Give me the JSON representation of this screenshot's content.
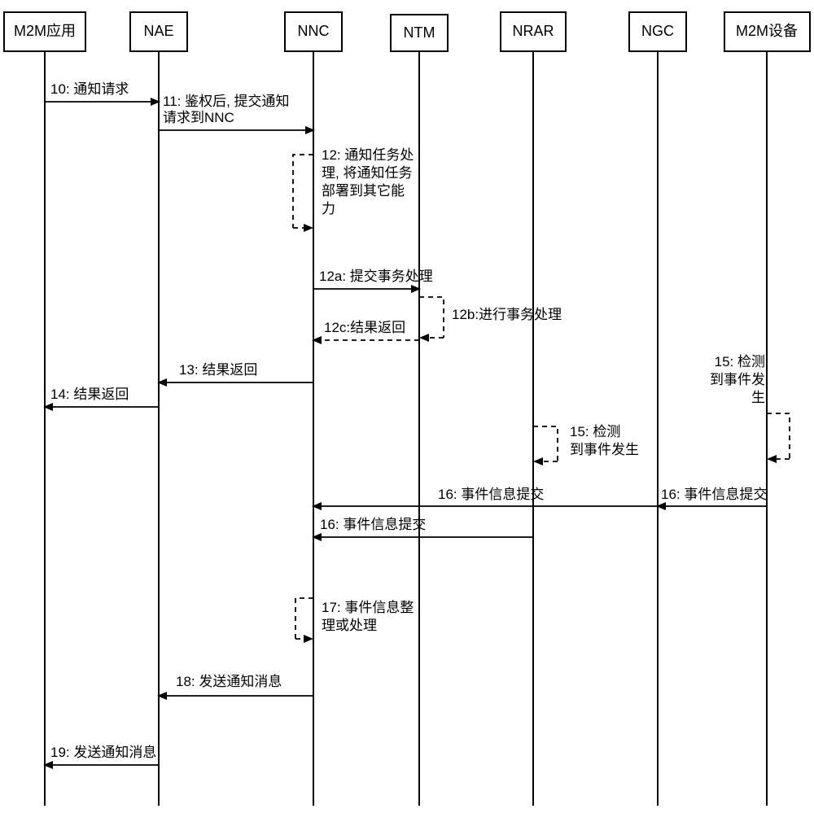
{
  "actors": {
    "a1": "M2M应用",
    "a2": "NAE",
    "a3": "NNC",
    "a4": "NTM",
    "a5": "NRAR",
    "a6": "NGC",
    "a7": "M2M设备"
  },
  "messages": {
    "m10": "10: 通知请求",
    "m11a": "11: 鉴权后, 提交通知",
    "m11b": "请求到NNC",
    "m12a": "12: 通知任务处",
    "m12b": "理, 将通知任务",
    "m12c": "部署到其它能",
    "m12d": "力",
    "m12aa": "12a: 提交事务处理",
    "m12bbA": "12b:进行事务处理",
    "m12cc": "12c:结果返回",
    "m13": "13: 结果返回",
    "m14": "14: 结果返回",
    "m15a": "15: 检测",
    "m15b": "到事件发生",
    "m15Ra": "15: 检测",
    "m15Rb": "到事件发",
    "m15Rc": "生",
    "m16a": "16: 事件信息提交",
    "m16b": "16: 事件信息提交",
    "m16c": "16: 事件信息提交",
    "m17a": "17: 事件信息整",
    "m17b": "理或处理",
    "m18": "18: 发送通知消息",
    "m19": "19: 发送通知消息"
  }
}
